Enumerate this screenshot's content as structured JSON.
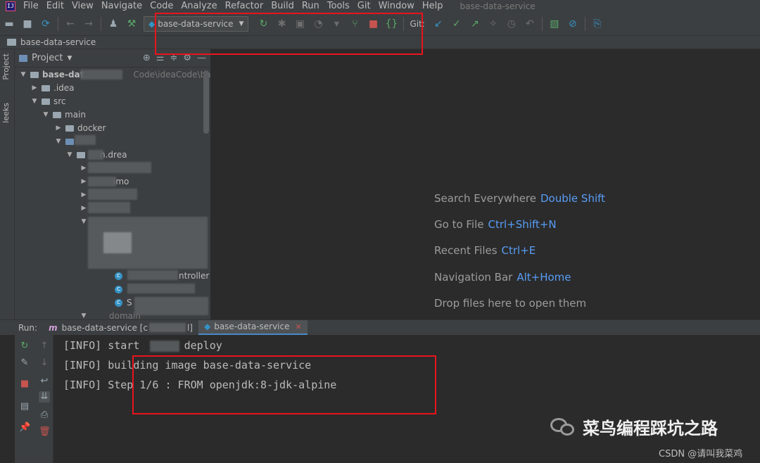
{
  "app_icon": "IJ",
  "menu": [
    "File",
    "Edit",
    "View",
    "Navigate",
    "Code",
    "Analyze",
    "Refactor",
    "Build",
    "Run",
    "Tools",
    "Git",
    "Window",
    "Help"
  ],
  "window_title": "base-data-service",
  "toolbar": {
    "run_config": "base-data-service",
    "git_label": "Git:"
  },
  "breadcrumb": "base-data-service",
  "left_strip": {
    "project_tab": "Project",
    "leeks_tab": "leeks"
  },
  "project_panel": {
    "title": "Project",
    "tree": {
      "root": "base-dat",
      "root_path": "Code\\ideaCode\\bas",
      "idea": ".idea",
      "src": "src",
      "main": "main",
      "docker": "docker",
      "pkg": "n.drea",
      "frag_mo": "imo",
      "frag_troller": "ntroller",
      "frag_s": "S",
      "domain": "domain"
    }
  },
  "editor_hints": [
    {
      "label": "Search Everywhere",
      "key": "Double Shift"
    },
    {
      "label": "Go to File",
      "key": "Ctrl+Shift+N"
    },
    {
      "label": "Recent Files",
      "key": "Ctrl+E"
    },
    {
      "label": "Navigation Bar",
      "key": "Alt+Home"
    },
    {
      "label": "Drop files here to open them",
      "key": ""
    }
  ],
  "run_panel": {
    "label": "Run:",
    "tab1": "base-data-service [c",
    "tab1_tail": "l]",
    "tab2": "base-data-service"
  },
  "console_lines": [
    "[INFO] start       deploy",
    "[INFO] building image base-data-service",
    "[INFO] Step 1/6 : FROM openjdk:8-jdk-alpine"
  ],
  "watermark": "菜鸟编程踩坑之路",
  "csdn_credit": "CSDN @请叫我菜鸡",
  "colors": {
    "highlight_box": "#e8141c",
    "accent": "#589df6",
    "background": "#2b2b2b"
  }
}
